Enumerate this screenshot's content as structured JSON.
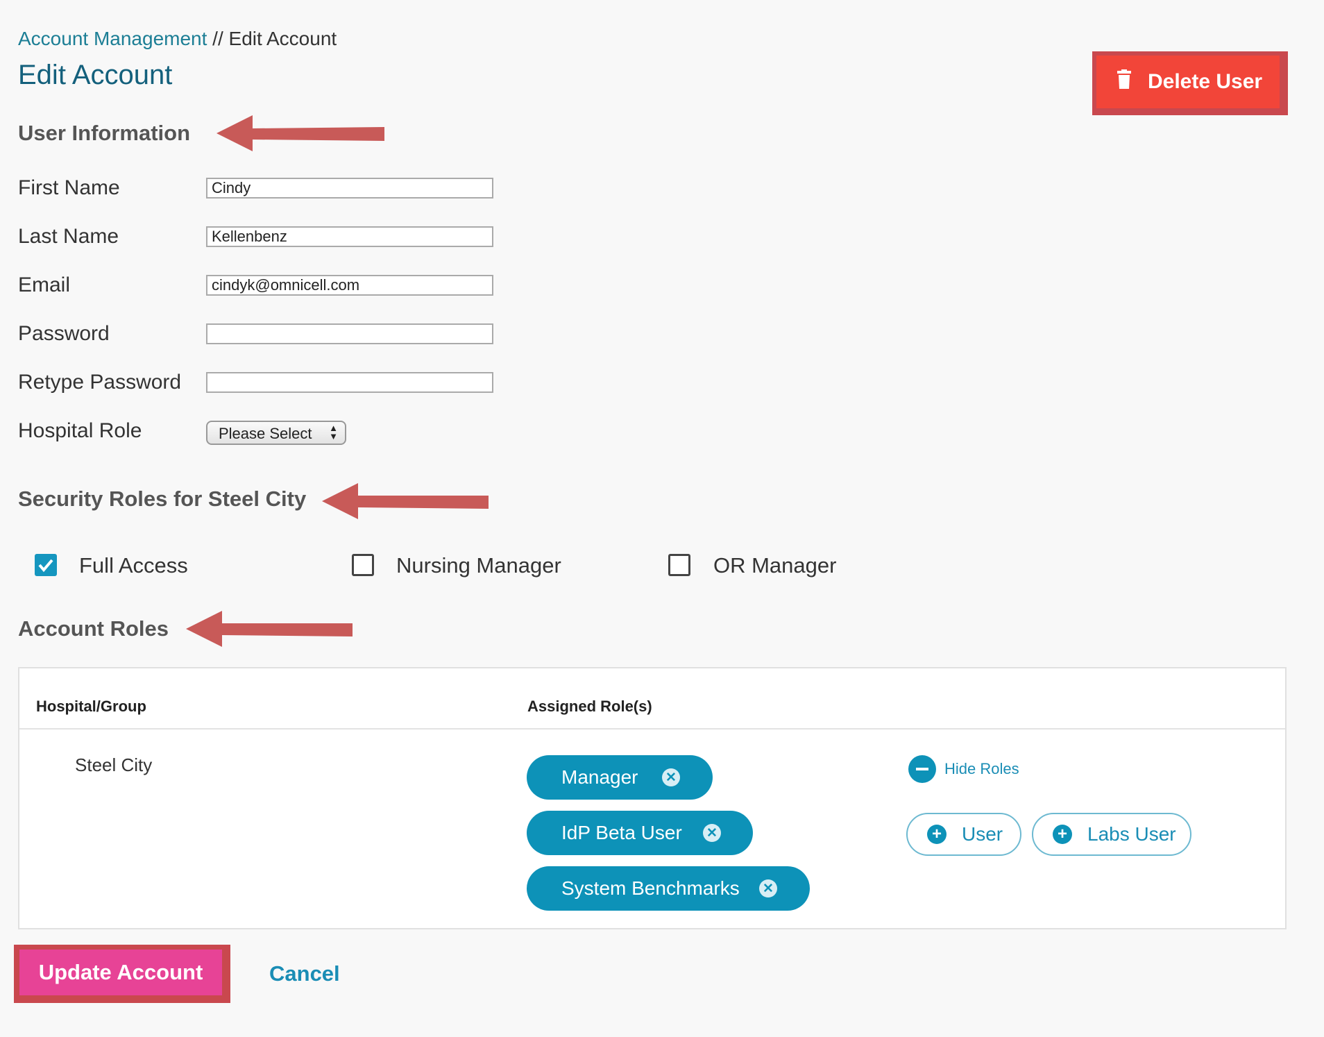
{
  "breadcrumb": {
    "link": "Account Management",
    "separator": "//",
    "current": "Edit Account"
  },
  "title": "Edit Account",
  "delete_button": {
    "label": "Delete User",
    "icon": "trash-icon",
    "color": "#f24539"
  },
  "user_info": {
    "heading": "User Information",
    "fields": {
      "first_name": {
        "label": "First Name",
        "value": "Cindy"
      },
      "last_name": {
        "label": "Last Name",
        "value": "Kellenbenz"
      },
      "email": {
        "label": "Email",
        "value": "cindyk@omnicell.com"
      },
      "password": {
        "label": "Password",
        "value": ""
      },
      "retype_password": {
        "label": "Retype Password",
        "value": ""
      },
      "hospital_role": {
        "label": "Hospital Role",
        "value": "Please Select"
      }
    }
  },
  "security_roles": {
    "heading": "Security Roles for Steel City",
    "options": [
      {
        "label": "Full Access",
        "checked": true
      },
      {
        "label": "Nursing Manager",
        "checked": false
      },
      {
        "label": "OR Manager",
        "checked": false
      }
    ]
  },
  "account_roles": {
    "heading": "Account Roles",
    "columns": [
      "Hospital/Group",
      "Assigned Role(s)"
    ],
    "row": {
      "group": "Steel City",
      "assigned": [
        "Manager",
        "IdP Beta User",
        "System Benchmarks"
      ],
      "hide_roles": "Hide Roles",
      "available": [
        "User",
        "Labs User"
      ]
    }
  },
  "actions": {
    "update": "Update Account",
    "cancel": "Cancel"
  },
  "colors": {
    "accent": "#0d92b8",
    "update": "#e74396",
    "annotation_arrow": "#c85a58"
  }
}
